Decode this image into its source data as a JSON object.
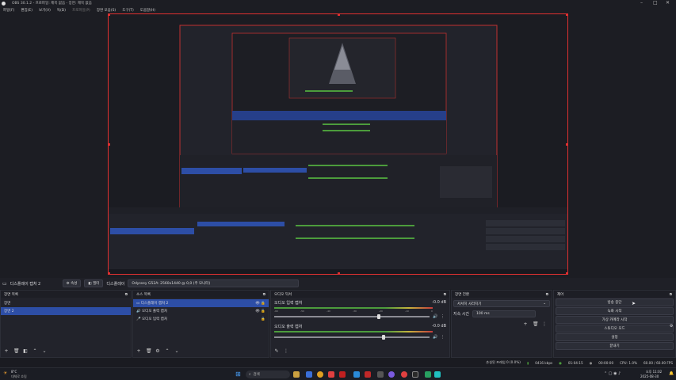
{
  "window": {
    "title": "OBS 30.1.2 - 프로파일: 제목 없음 - 장면: 제목 없음"
  },
  "menu": [
    "파일(F)",
    "편집(E)",
    "보기(V)",
    "독(D)",
    "프로파일(P)",
    "장면 모음(S)",
    "도구(T)",
    "도움말(H)"
  ],
  "source_bar": {
    "source_name": "디스플레이 캡처 2",
    "properties_label": "속성",
    "filters_label": "필터",
    "display_label": "디스플레이",
    "display_value": "Odyssey G52A: 2560x1440 @ 0,0 (주 모니터)"
  },
  "scenes": {
    "title": "장면 목록",
    "items": [
      "장면",
      "장면 2"
    ],
    "selected": 1
  },
  "sources": {
    "title": "소스 목록",
    "items": [
      {
        "label": "디스플레이 캡처 2",
        "icon": "monitor-icon"
      },
      {
        "label": "오디오 출력 캡처",
        "icon": "speaker-icon"
      },
      {
        "label": "오디오 입력 캡처",
        "icon": "mic-icon"
      }
    ]
  },
  "mixer": {
    "title": "오디오 믹서",
    "channels": [
      {
        "name": "오디오 입력 캡처",
        "db": "-0.0 dB"
      },
      {
        "name": "오디오 출력 캡처",
        "db": "-0.0 dB"
      }
    ],
    "ticks": [
      "-60",
      "-55",
      "-50",
      "-45",
      "-40",
      "-35",
      "-30",
      "-25",
      "-20",
      "-15",
      "-10",
      "-5",
      "0"
    ]
  },
  "transitions": {
    "title": "장면 전환",
    "type": "서서히 사라지기",
    "duration_label": "지속 시간",
    "duration_value": "100 ms"
  },
  "controls": {
    "title": "제어",
    "buttons": [
      "방송 중단",
      "녹화 시작",
      "가상 카메라 시작",
      "스튜디오 모드",
      "설정",
      "끝내기"
    ]
  },
  "status": {
    "dropped": "손실된 프레임 0 (0.0%)",
    "kbps": "0416 kbps",
    "stream_time": "01:04:15",
    "rec_time": "00:00:00",
    "cpu": "CPU: 1.0%",
    "fps": "60.00 / 60.00 FPS"
  },
  "taskbar": {
    "weather_temp": "8°C",
    "weather_desc": "대체로 흐림",
    "search_placeholder": "검색",
    "time": "오후 11:02",
    "date": "2025-08-30"
  }
}
